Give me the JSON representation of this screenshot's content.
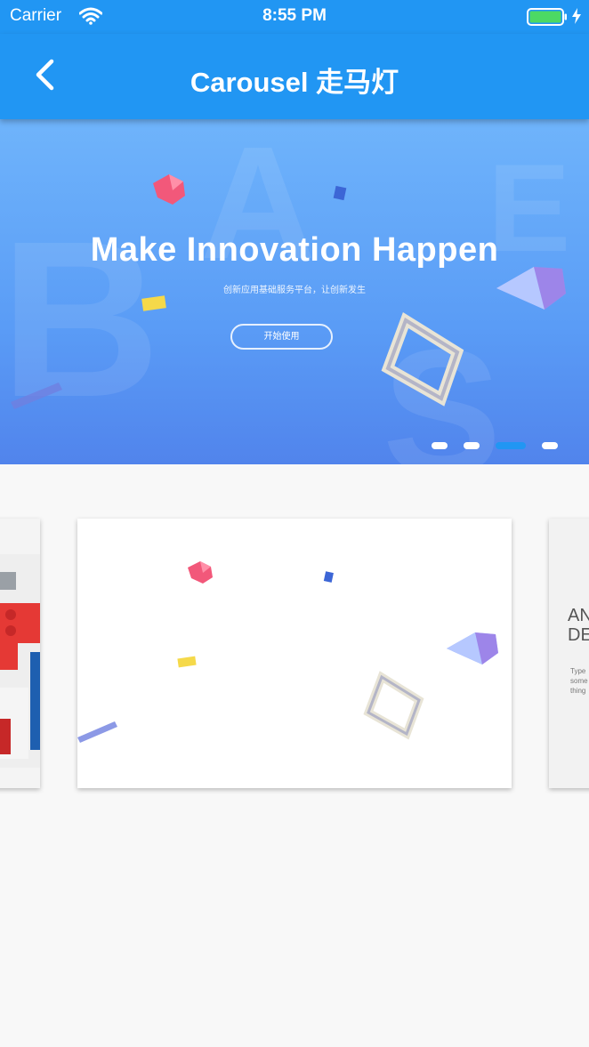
{
  "status_bar": {
    "carrier": "Carrier",
    "time": "8:55 PM",
    "battery_color": "#4cd964"
  },
  "app_bar": {
    "title": "Carousel 走马灯",
    "back_icon": "chevron-left-icon",
    "color": "#2196f3"
  },
  "banner": {
    "headline": "Make Innovation Happen",
    "subtitle": "创新应用基础服务平台，让创新发生",
    "cta_label": "开始使用",
    "bg_letters": [
      "A",
      "B",
      "E",
      "S"
    ]
  },
  "main_carousel": {
    "slide_count": 4,
    "active_index": 2,
    "indicator_active_color": "#2196f3",
    "indicator_inactive_color": "#ffffff"
  },
  "card_carousel": {
    "right_card_title_lines": [
      "AN",
      "DE"
    ],
    "right_card_text_lines": [
      "Type",
      "some",
      "thing"
    ]
  }
}
